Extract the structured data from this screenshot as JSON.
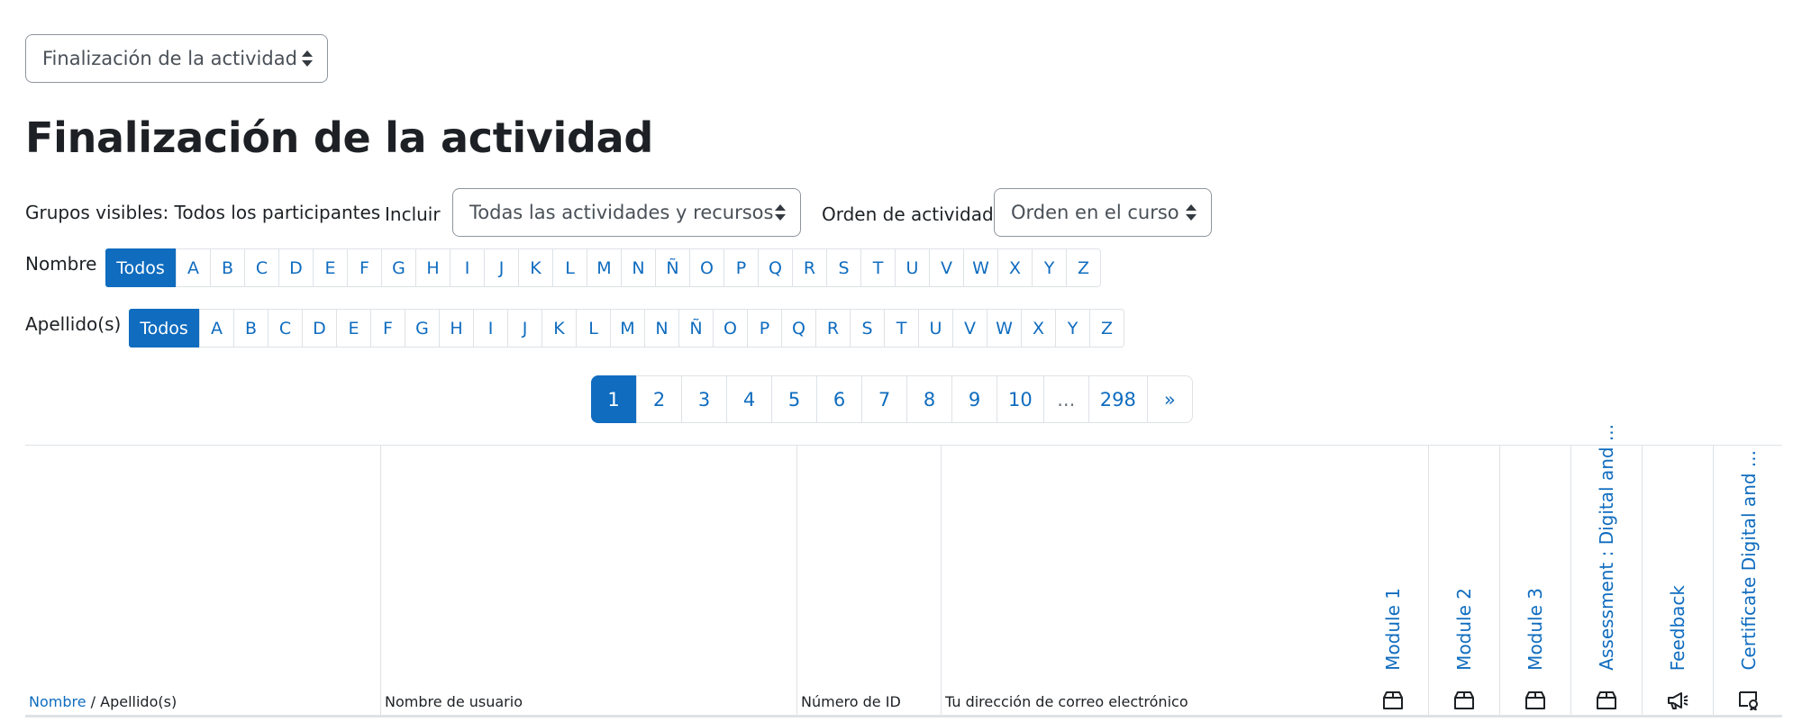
{
  "report_select": {
    "value": "Finalización de la actividad"
  },
  "page_title": "Finalización de la actividad",
  "filters": {
    "groups_text": "Grupos visibles: Todos los participantes",
    "include_label": "Incluir",
    "include_value": "Todas las actividades y recursos",
    "order_label": "Orden de actividad",
    "order_value": "Orden en el curso"
  },
  "firstname_filter": {
    "label": "Nombre",
    "letters": [
      "Todos",
      "A",
      "B",
      "C",
      "D",
      "E",
      "F",
      "G",
      "H",
      "I",
      "J",
      "K",
      "L",
      "M",
      "N",
      "Ñ",
      "O",
      "P",
      "Q",
      "R",
      "S",
      "T",
      "U",
      "V",
      "W",
      "X",
      "Y",
      "Z"
    ]
  },
  "lastname_filter": {
    "label": "Apellido(s)",
    "letters": [
      "Todos",
      "A",
      "B",
      "C",
      "D",
      "E",
      "F",
      "G",
      "H",
      "I",
      "J",
      "K",
      "L",
      "M",
      "N",
      "Ñ",
      "O",
      "P",
      "Q",
      "R",
      "S",
      "T",
      "U",
      "V",
      "W",
      "X",
      "Y",
      "Z"
    ]
  },
  "pagination": [
    "1",
    "2",
    "3",
    "4",
    "5",
    "6",
    "7",
    "8",
    "9",
    "10",
    "...",
    "298",
    "»"
  ],
  "table": {
    "col_name_link": "Nombre",
    "col_name_sep": " / ",
    "col_name_rest": "Apellido(s)",
    "col_username": "Nombre de usuario",
    "col_id": "Número de ID",
    "col_email": "Tu dirección de correo electrónico",
    "activities": [
      {
        "label": "Module 1",
        "icon": "package-icon"
      },
      {
        "label": "Module 2",
        "icon": "package-icon"
      },
      {
        "label": "Module 3",
        "icon": "package-icon"
      },
      {
        "label": "Assessment : Digital and ...",
        "icon": "package-icon"
      },
      {
        "label": "Feedback",
        "icon": "megaphone-icon"
      },
      {
        "label": "Certificate Digital and ...",
        "icon": "certificate-icon"
      }
    ]
  },
  "colors": {
    "accent": "#0f6cbf",
    "border": "#dee2e6",
    "text": "#1d2125"
  }
}
